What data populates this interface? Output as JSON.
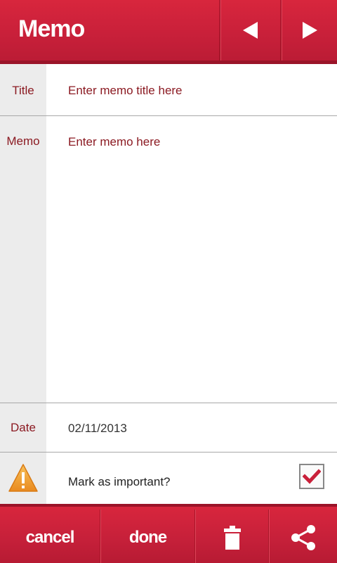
{
  "header": {
    "title": "Memo",
    "prev_icon": "left-arrow-icon",
    "next_icon": "right-arrow-icon"
  },
  "form": {
    "title_label": "Title",
    "title_placeholder": "Enter memo title here",
    "memo_label": "Memo",
    "memo_placeholder": "Enter memo here",
    "date_label": "Date",
    "date_value": "02/11/2013",
    "important_label": "Mark as important?",
    "important_icon": "warning-icon",
    "important_checked": true
  },
  "footer": {
    "cancel_label": "cancel",
    "done_label": "done",
    "delete_icon": "trash-icon",
    "share_icon": "share-icon"
  },
  "colors": {
    "accent": "#c9203a",
    "label_text": "#8b1a22",
    "label_bg": "#ececec",
    "warning": "#f0a030",
    "check": "#c9203a"
  }
}
